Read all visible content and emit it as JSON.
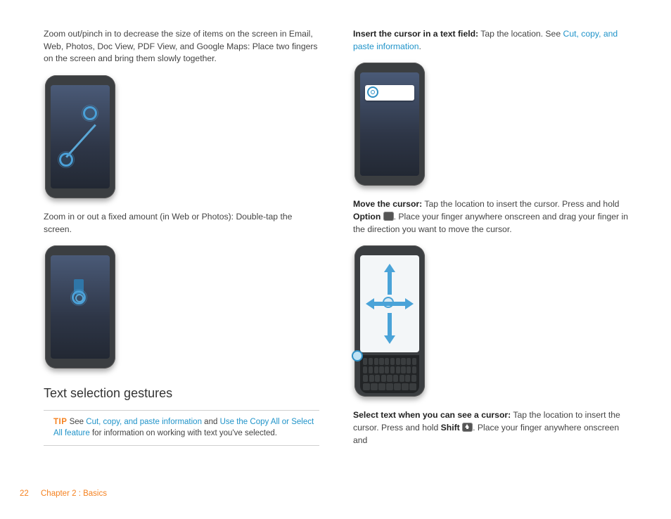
{
  "left": {
    "zoom_out_text": "Zoom out/pinch in to decrease the size of items on the screen in Email, Web, Photos, Doc View, PDF View, and Google Maps: Place two fingers on the screen and bring them slowly together.",
    "zoom_fixed_text": "Zoom in or out a fixed amount (in Web or Photos): Double-tap the screen.",
    "section_title": "Text selection gestures",
    "tip": {
      "label": "TIP",
      "pre": "See ",
      "link1": "Cut, copy, and paste information",
      "mid": " and ",
      "link2": "Use the Copy All or Select All feature",
      "post": " for information on working with text you've selected."
    }
  },
  "right": {
    "insert_bold": "Insert the cursor in a text field:",
    "insert_rest": " Tap the location. See ",
    "insert_link": "Cut, copy, and paste information",
    "insert_end": ".",
    "move_bold": "Move the cursor:",
    "move_rest_a": " Tap the location to insert the cursor. Press and hold ",
    "move_option": "Option",
    "move_rest_b": ". Place your finger anywhere onscreen and drag your finger in the direction you want to move the cursor.",
    "select_bold": "Select text when you can see a cursor:",
    "select_rest_a": " Tap the location to insert the cursor. Press and hold ",
    "select_shift": "Shift",
    "select_rest_b": ". Place your finger anywhere onscreen and"
  },
  "footer": {
    "page": "22",
    "chapter": "Chapter 2 : Basics"
  }
}
